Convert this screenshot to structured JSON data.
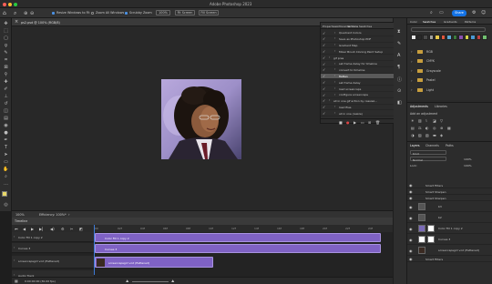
{
  "app": {
    "title": "Adobe Photoshop 2023",
    "share_label": "Share"
  },
  "options_bar": {
    "resize_windows": "Resize Windows to Fit",
    "zoom_all": "Zoom All Windows",
    "scrubby_zoom": "Scrubby Zoom",
    "zoom_value": "100%",
    "fit_screen": "Fit Screen",
    "fill_screen": "Fill Screen"
  },
  "document": {
    "tab_label": "ps2.psd @ 100% (RGB/8)",
    "zoom": "100%",
    "efficiency": "Efficiency: 100%*"
  },
  "actions_panel": {
    "tabs": [
      "Properties",
      "Artboards",
      "Actions",
      "Swatches"
    ],
    "active_tab": "Actions",
    "items": [
      "Quadrant Colors",
      "Save as Photoshop PDF",
      "Gradient Map",
      "Mixer Brush Cloning Paint Setup",
      "gif pres",
      "set frame delay for timeline",
      "convert to timeline",
      "flatten",
      "set frame delay",
      "load screencaps",
      "configure screencaps",
      "all in one gif action by cassiez...",
      "load files",
      "all in one (resize)"
    ]
  },
  "swatches_panel": {
    "tabs": [
      "Color",
      "Swatches",
      "Gradients",
      "Patterns"
    ],
    "active_tab": "Swatches",
    "search_placeholder": "",
    "folders": [
      "RGB",
      "CMYK",
      "Grayscale",
      "Pastel",
      "Light"
    ],
    "colors": [
      "#e8e8e8",
      "#2a2a2a",
      "#4a4a4a",
      "#a0a0a0",
      "#e6c84a",
      "#e2573b",
      "#5ba8d4",
      "#3c7a3c",
      "#8a4fb0",
      "#d4d44a",
      "#4a9ad4",
      "#c04040",
      "#70c070"
    ]
  },
  "adjustments_panel": {
    "tabs": [
      "Adjustments",
      "Libraries"
    ],
    "add_label": "Add an adjustment"
  },
  "layers_panel": {
    "tabs": [
      "Layers",
      "Channels",
      "Paths"
    ],
    "blend_mode": "Normal",
    "opacity": "100%",
    "lock_label": "Lock:",
    "fill": "100%",
    "filter_kind": "Kind",
    "layers": [
      {
        "name": "Smart Filters",
        "indent": true
      },
      {
        "name": "Smart Sharpen",
        "indent": true
      },
      {
        "name": "Smart Sharpen",
        "indent": true
      },
      {
        "name": "b3",
        "indent": false
      },
      {
        "name": "b2",
        "indent": false
      },
      {
        "name": "Color Fill 1 copy 2",
        "indent": false
      },
      {
        "name": "Curves 3",
        "indent": false
      },
      {
        "name": "screencapsgirl vo2 (flattened)",
        "indent": false
      },
      {
        "name": "Smart Filters",
        "indent": true
      }
    ]
  },
  "timeline": {
    "title": "Timeline",
    "ruler": [
      "00",
      "02f",
      "04f",
      "06f",
      "08f",
      "10f",
      "12f",
      "14f",
      "16f",
      "18f",
      "20f",
      "22f",
      "24f"
    ],
    "tracks": [
      "Color Fill 1 copy 2",
      "Curves 3",
      "screencapsgirl vo2 (flattened)",
      "Audio Track"
    ],
    "clips": [
      "Color Fill 1 copy 2",
      "Curves 3",
      "screencapsgirl vo2 (flattened)"
    ],
    "frame_rate": "0:00:00:00 (30.00 fps)"
  }
}
